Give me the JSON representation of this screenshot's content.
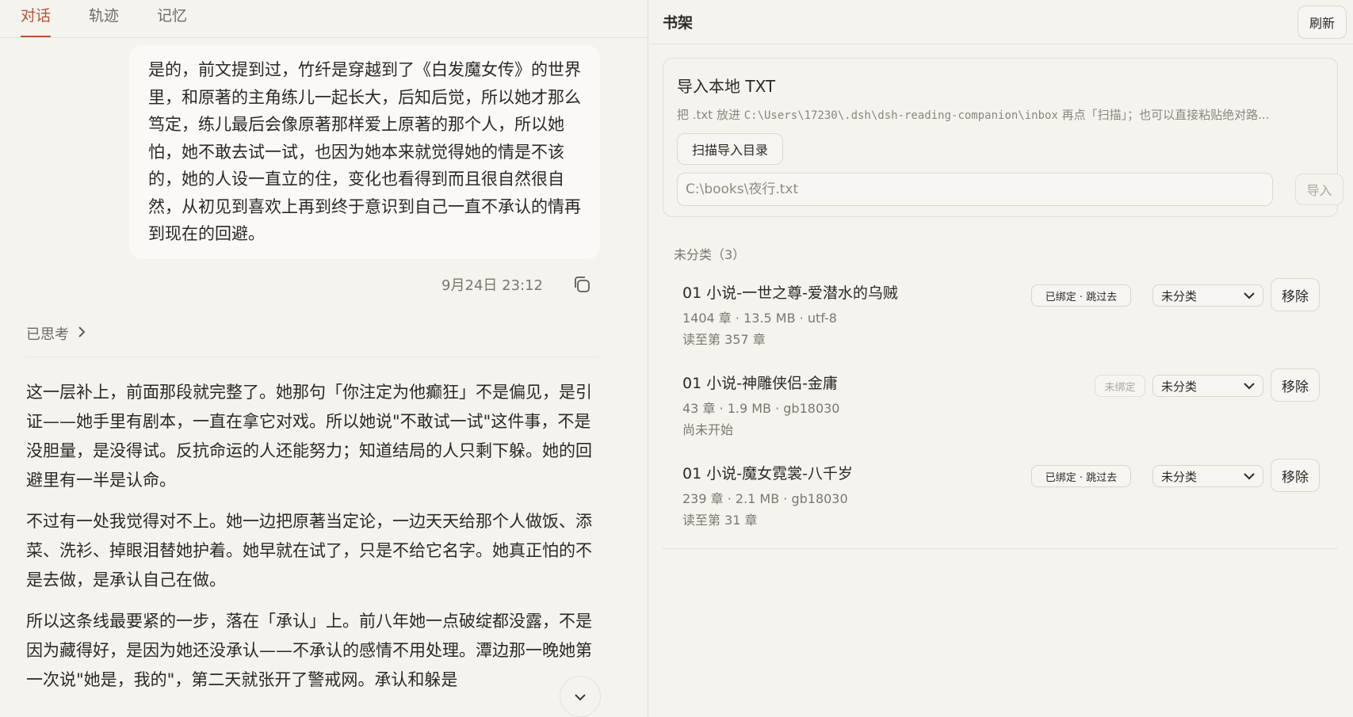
{
  "tabs": [
    {
      "label": "对话",
      "active": true
    },
    {
      "label": "轨迹",
      "active": false
    },
    {
      "label": "记忆",
      "active": false
    }
  ],
  "chat": {
    "user_message": "是的，前文提到过，竹纤是穿越到了《白发魔女传》的世界里，和原著的主角练儿一起长大，后知后觉，所以她才那么笃定，练儿最后会像原著那样爱上原著的那个人，所以她怕，她不敢去试一试，也因为她本来就觉得她的情是不该的，她的人设一直立的住，变化也看得到而且很自然很自然，从初见到喜欢上再到终于意识到自己一直不承认的情再到现在的回避。",
    "timestamp": "9月24日 23:12",
    "thought_label": "已思考",
    "answer_paragraphs": [
      "这一层补上，前面那段就完整了。她那句「你注定为他癫狂」不是偏见，是引证——她手里有剧本，一直在拿它对戏。所以她说\"不敢试一试\"这件事，不是没胆量，是没得试。反抗命运的人还能努力；知道结局的人只剩下躲。她的回避里有一半是认命。",
      "不过有一处我觉得对不上。她一边把原著当定论，一边天天给那个人做饭、添菜、洗衫、掉眼泪替她护着。她早就在试了，只是不给它名字。她真正怕的不是去做，是承认自己在做。",
      "所以这条线最要紧的一步，落在「承认」上。前八年她一点破绽都没露，不是因为藏得好，是因为她还没承认——不承认的感情不用处理。潭边那一晚她第一次说\"她是，我的\"，第二天就张开了警戒网。承认和躲是"
    ]
  },
  "shelf": {
    "title": "书架",
    "refresh_label": "刷新",
    "import": {
      "title": "导入本地 TXT",
      "hint_prefix": "把 .txt 放进 ",
      "hint_path": "C:\\Users\\17230\\.dsh\\dsh-reading-companion\\inbox",
      "hint_suffix": " 再点「扫描」；也可以直接粘贴绝对路...",
      "scan_label": "扫描导入目录",
      "path_placeholder": "C:\\books\\夜行.txt",
      "import_label": "导入"
    },
    "category": "未分类（3）",
    "books": [
      {
        "title": "01 小说-一世之尊-爱潜水的乌贼",
        "meta": "1404 章 · 13.5 MB · utf-8",
        "progress": "读至第 357 章",
        "bind_status": "已绑定 · 跳过去",
        "bound": true,
        "category": "未分类",
        "remove_label": "移除"
      },
      {
        "title": "01 小说-神雕侠侣-金庸",
        "meta": "43 章 · 1.9 MB · gb18030",
        "progress": "尚未开始",
        "bind_status": "未绑定",
        "bound": false,
        "category": "未分类",
        "remove_label": "移除"
      },
      {
        "title": "01 小说-魔女霓裳-八千岁",
        "meta": "239 章 · 2.1 MB · gb18030",
        "progress": "读至第 31 章",
        "bind_status": "已绑定 · 跳过去",
        "bound": true,
        "category": "未分类",
        "remove_label": "移除"
      }
    ]
  },
  "colors": {
    "accent": "#b4543a",
    "background": "#f5f3ee"
  }
}
